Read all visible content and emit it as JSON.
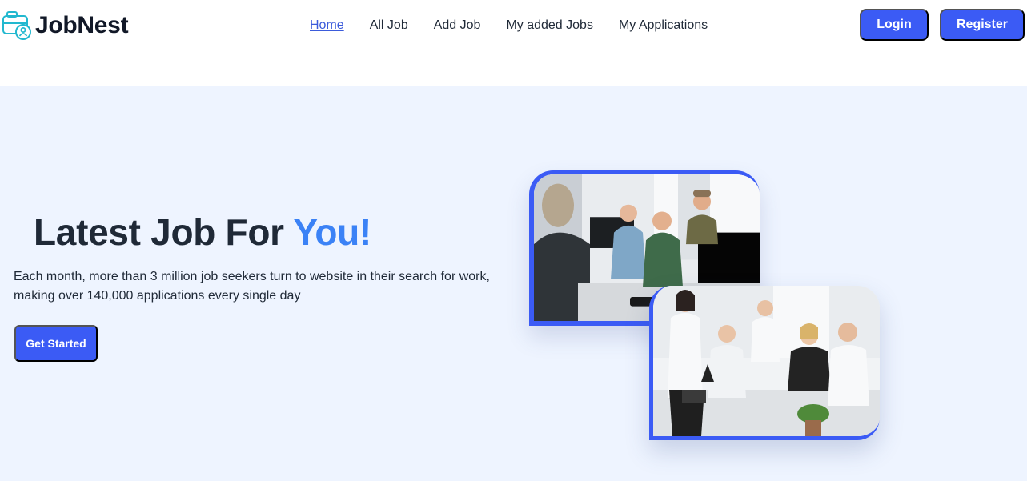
{
  "brand": {
    "name": "JobNest",
    "icon": "briefcase-user-icon"
  },
  "nav": {
    "items": [
      {
        "label": "Home",
        "active": true
      },
      {
        "label": "All Job",
        "active": false
      },
      {
        "label": "Add Job",
        "active": false
      },
      {
        "label": "My added Jobs",
        "active": false
      },
      {
        "label": "My Applications",
        "active": false
      }
    ]
  },
  "auth": {
    "login_label": "Login",
    "register_label": "Register"
  },
  "hero": {
    "title_main": "Latest Job For ",
    "title_accent": "You!",
    "description": "Each month, more than 3 million job seekers turn to website in their search for work, making over 140,000 applications every single day",
    "cta_label": "Get Started"
  },
  "colors": {
    "primary": "#3b5bf5",
    "accent": "#3b82f6",
    "hero_bg": "#eef4ff",
    "brand_icon": "#22b8cf"
  }
}
